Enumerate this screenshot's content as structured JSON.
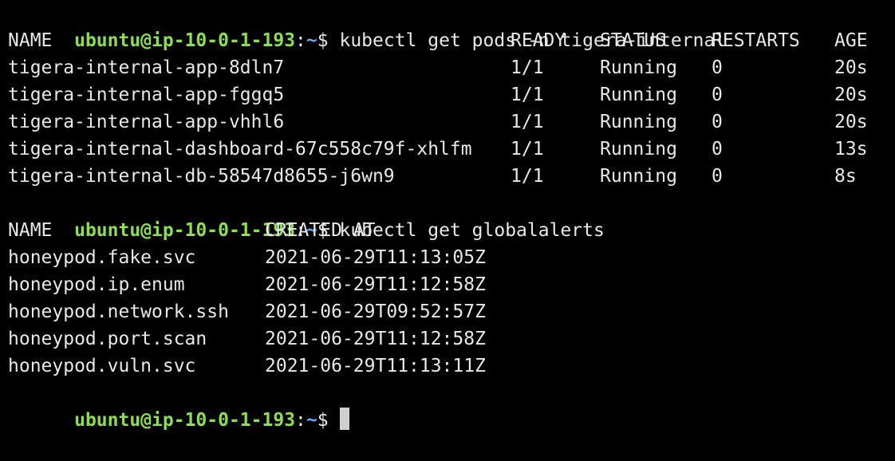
{
  "prompt": {
    "user_host": "ubuntu@ip-10-0-1-193",
    "colon": ":",
    "path": "~",
    "dollar": "$"
  },
  "commands": {
    "first": "kubectl get pods -n tigera-internal",
    "second": "kubectl get globalalerts"
  },
  "pods_table": {
    "headers": [
      "NAME",
      "READY",
      "STATUS",
      "RESTARTS",
      "AGE"
    ],
    "rows": [
      [
        "tigera-internal-app-8dln7",
        "1/1",
        "Running",
        "0",
        "20s"
      ],
      [
        "tigera-internal-app-fggq5",
        "1/1",
        "Running",
        "0",
        "20s"
      ],
      [
        "tigera-internal-app-vhhl6",
        "1/1",
        "Running",
        "0",
        "20s"
      ],
      [
        "tigera-internal-dashboard-67c558c79f-xhlfm",
        "1/1",
        "Running",
        "0",
        "13s"
      ],
      [
        "tigera-internal-db-58547d8655-j6wn9",
        "1/1",
        "Running",
        "0",
        "8s"
      ]
    ]
  },
  "alerts_table": {
    "headers": [
      "NAME",
      "CREATED AT"
    ],
    "rows": [
      [
        "honeypod.fake.svc",
        "2021-06-29T11:13:05Z"
      ],
      [
        "honeypod.ip.enum",
        "2021-06-29T11:12:58Z"
      ],
      [
        "honeypod.network.ssh",
        "2021-06-29T09:52:57Z"
      ],
      [
        "honeypod.port.scan",
        "2021-06-29T11:12:58Z"
      ],
      [
        "honeypod.vuln.svc",
        "2021-06-29T11:13:11Z"
      ]
    ]
  },
  "colors": {
    "background": "#000000",
    "text": "#e8e8e8",
    "prompt_user": "#8be04e",
    "prompt_path": "#6aa6ff",
    "cursor": "#cfcfcf"
  }
}
